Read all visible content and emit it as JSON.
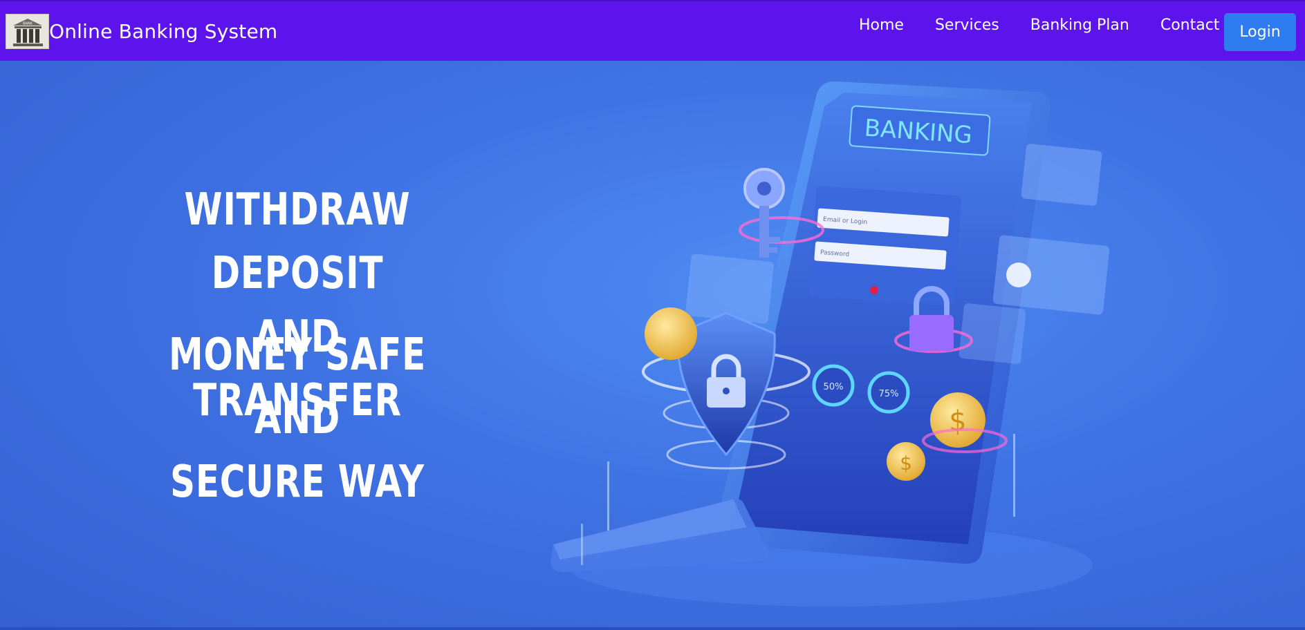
{
  "brand": {
    "title": "Online Banking System",
    "logo_text": "BANK"
  },
  "nav": {
    "links": [
      "Home",
      "Services",
      "Banking Plan",
      "Contact"
    ],
    "login_label": "Login"
  },
  "hero": {
    "headline_line1": "WITHDRAW DEPOSIT",
    "headline_line2": "AND TRANSFER",
    "headline_line3": "MONEY SAFE AND",
    "headline_line4": "SECURE WAY",
    "illustration": {
      "banner_text": "BANKING",
      "email_placeholder": "Email or Login",
      "password_placeholder": "Password",
      "gauge_1": "50%",
      "gauge_2": "75%"
    }
  },
  "colors": {
    "navbar": "#5d14ec",
    "login_button": "#2f7cf0",
    "hero_background": "#3f72e3"
  }
}
